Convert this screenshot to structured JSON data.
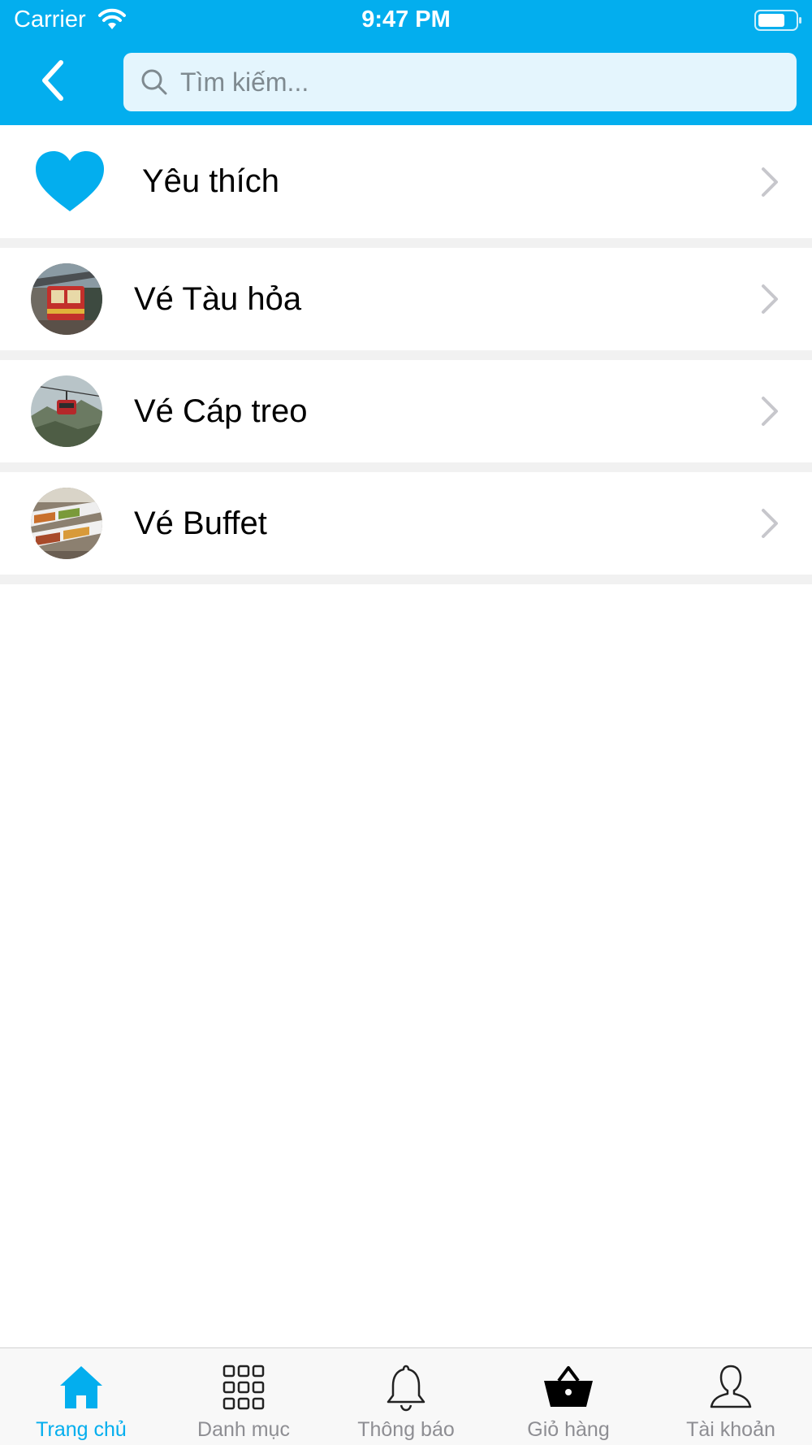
{
  "status_bar": {
    "carrier": "Carrier",
    "time": "9:47 PM"
  },
  "header": {
    "back_icon": "chevron-left-icon",
    "search": {
      "placeholder": "Tìm kiếm...",
      "value": ""
    }
  },
  "menu": {
    "items": [
      {
        "label": "Yêu thích",
        "icon": "heart-icon"
      },
      {
        "label": "Vé Tàu hỏa",
        "icon": "train-photo"
      },
      {
        "label": "Vé Cáp treo",
        "icon": "cable-car-photo"
      },
      {
        "label": "Vé Buffet",
        "icon": "buffet-photo"
      }
    ]
  },
  "tabbar": {
    "tabs": [
      {
        "label": "Trang chủ",
        "icon": "home-icon",
        "active": true
      },
      {
        "label": "Danh mục",
        "icon": "grid-icon",
        "active": false
      },
      {
        "label": "Thông báo",
        "icon": "bell-icon",
        "active": false
      },
      {
        "label": "Giỏ hàng",
        "icon": "basket-icon",
        "active": false
      },
      {
        "label": "Tài khoản",
        "icon": "user-icon",
        "active": false
      }
    ]
  },
  "colors": {
    "accent": "#03aeee",
    "search_bg": "#e4f5fd",
    "separator": "#f1f1f1",
    "tab_inactive": "#8e8e93",
    "chevron": "#c7c7cc"
  }
}
